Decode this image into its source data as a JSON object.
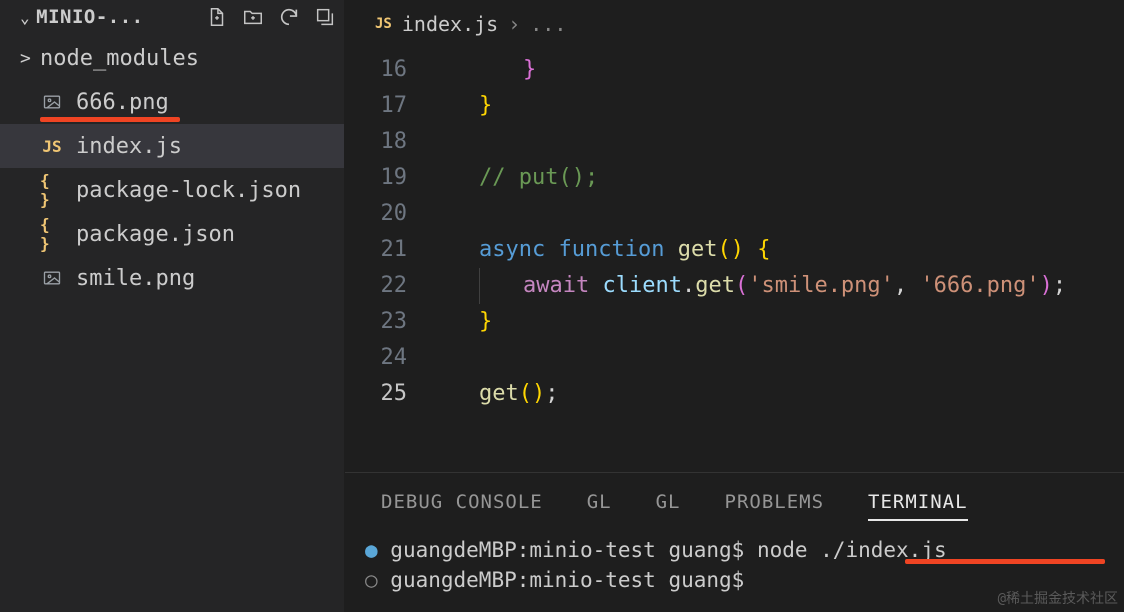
{
  "sidebar": {
    "title": "MINIO-...",
    "items": [
      {
        "name": "node_modules",
        "icon": "folder",
        "chevron": ">"
      },
      {
        "name": "666.png",
        "icon": "image",
        "underline": true
      },
      {
        "name": "index.js",
        "icon": "js",
        "active": true
      },
      {
        "name": "package-lock.json",
        "icon": "json"
      },
      {
        "name": "package.json",
        "icon": "json"
      },
      {
        "name": "smile.png",
        "icon": "image"
      }
    ]
  },
  "breadcrumb": {
    "file": "index.js",
    "sep": "›",
    "rest": "..."
  },
  "editor": {
    "lines": [
      {
        "num": "16",
        "tokens": [
          {
            "t": "indent"
          },
          {
            "t": "indent"
          },
          {
            "c": "tk-brace2",
            "v": "}"
          }
        ]
      },
      {
        "num": "17",
        "tokens": [
          {
            "t": "indent"
          },
          {
            "c": "tk-brace",
            "v": "}"
          }
        ]
      },
      {
        "num": "18",
        "tokens": []
      },
      {
        "num": "19",
        "tokens": [
          {
            "t": "indent"
          },
          {
            "c": "tk-comment",
            "v": "// put();"
          }
        ]
      },
      {
        "num": "20",
        "tokens": []
      },
      {
        "num": "21",
        "tokens": [
          {
            "t": "indent"
          },
          {
            "c": "tk-kw",
            "v": "async"
          },
          {
            "c": "tk-plain",
            "v": " "
          },
          {
            "c": "tk-kw",
            "v": "function"
          },
          {
            "c": "tk-plain",
            "v": " "
          },
          {
            "c": "tk-fn",
            "v": "get"
          },
          {
            "c": "tk-brace",
            "v": "()"
          },
          {
            "c": "tk-plain",
            "v": " "
          },
          {
            "c": "tk-brace",
            "v": "{"
          }
        ]
      },
      {
        "num": "22",
        "tokens": [
          {
            "t": "indent"
          },
          {
            "t": "indentg"
          },
          {
            "c": "tk-kw2",
            "v": "await"
          },
          {
            "c": "tk-plain",
            "v": " "
          },
          {
            "c": "tk-var",
            "v": "client"
          },
          {
            "c": "tk-dot",
            "v": "."
          },
          {
            "c": "tk-fn",
            "v": "get"
          },
          {
            "c": "tk-paren2",
            "v": "("
          },
          {
            "c": "tk-str",
            "v": "'smile.png'"
          },
          {
            "c": "tk-plain",
            "v": ", "
          },
          {
            "c": "tk-str",
            "v": "'666.png'"
          },
          {
            "c": "tk-paren2",
            "v": ")"
          },
          {
            "c": "tk-plain",
            "v": ";"
          }
        ]
      },
      {
        "num": "23",
        "tokens": [
          {
            "t": "indent"
          },
          {
            "c": "tk-brace",
            "v": "}"
          }
        ]
      },
      {
        "num": "24",
        "tokens": []
      },
      {
        "num": "25",
        "current": true,
        "tokens": [
          {
            "t": "indent"
          },
          {
            "c": "tk-fn",
            "v": "get"
          },
          {
            "c": "tk-brace",
            "v": "()"
          },
          {
            "c": "tk-plain",
            "v": ";"
          }
        ]
      }
    ]
  },
  "panel": {
    "tabs": [
      "DEBUG CONSOLE",
      "GL",
      "GL",
      "PROBLEMS",
      "TERMINAL"
    ],
    "activeTab": 4,
    "lines": [
      {
        "dot": "●",
        "dotClass": "term-dot",
        "text": "guangdeMBP:minio-test guang$ node ./index.js",
        "redline": true
      },
      {
        "dot": "○",
        "dotClass": "term-dot2",
        "text": "guangdeMBP:minio-test guang$ "
      }
    ]
  },
  "watermark": "@稀土掘金技术社区"
}
